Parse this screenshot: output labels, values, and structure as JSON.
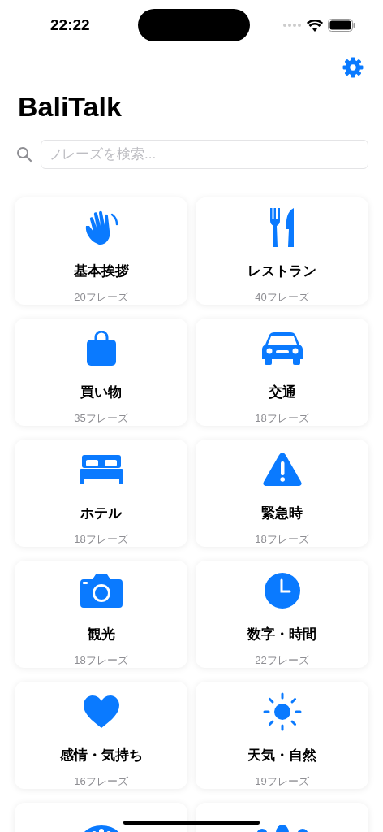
{
  "status_bar": {
    "time": "22:22"
  },
  "app_title": "BaliTalk",
  "search": {
    "placeholder": "フレーズを検索..."
  },
  "categories": [
    {
      "kind": "full",
      "name": "基本挨拶",
      "count": "20フレーズ"
    },
    {
      "kind": "full",
      "name": "レストラン",
      "count": "40フレーズ"
    },
    {
      "kind": "full",
      "name": "買い物",
      "count": "35フレーズ"
    },
    {
      "kind": "full",
      "name": "交通",
      "count": "18フレーズ"
    },
    {
      "kind": "full",
      "name": "ホテル",
      "count": "18フレーズ"
    },
    {
      "kind": "full",
      "name": "緊急時",
      "count": "18フレーズ"
    },
    {
      "kind": "full",
      "name": "観光",
      "count": "18フレーズ"
    },
    {
      "kind": "full",
      "name": "数字・時間",
      "count": "22フレーズ"
    },
    {
      "kind": "full",
      "name": "感情・気持ち",
      "count": "16フレーズ"
    },
    {
      "kind": "full",
      "name": "天気・自然",
      "count": "19フレーズ"
    },
    {
      "kind": "cut_off"
    },
    {
      "kind": "cut_off"
    }
  ]
}
